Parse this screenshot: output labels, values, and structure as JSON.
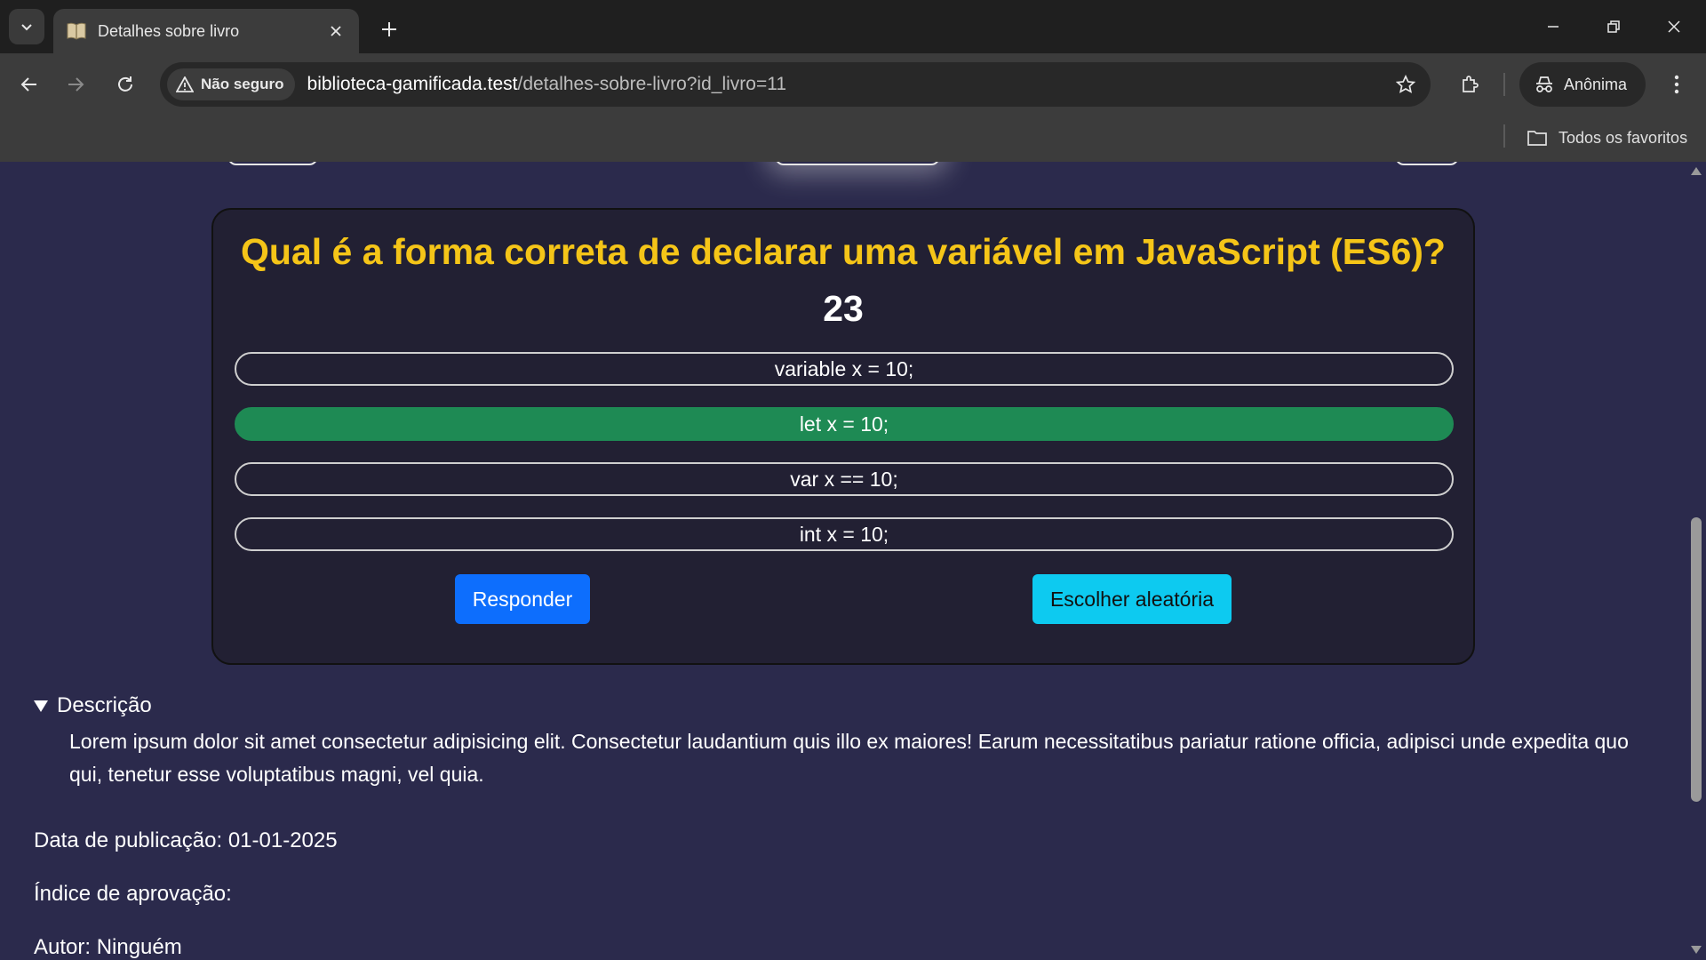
{
  "browser": {
    "tab_title": "Detalhes sobre livro",
    "security_label": "Não seguro",
    "url_host": "biblioteca-gamificada.test",
    "url_path": "/detalhes-sobre-livro?id_livro=11",
    "profile_label": "Anônima",
    "bookmarks_folder": "Todos os favoritos"
  },
  "quiz": {
    "question": "Qual é a forma correta de declarar uma variável em JavaScript (ES6)?",
    "number": "23",
    "options": [
      {
        "label": "variable x = 10;",
        "selected": false
      },
      {
        "label": "let x = 10;",
        "selected": true
      },
      {
        "label": "var x == 10;",
        "selected": false
      },
      {
        "label": "int x = 10;",
        "selected": false
      }
    ],
    "submit_label": "Responder",
    "random_label": "Escolher aleatória",
    "selected_color": "#1e8a54"
  },
  "details": {
    "summary_label": "Descrição",
    "description": "Lorem ipsum dolor sit amet consectetur adipisicing elit. Consectetur laudantium quis illo ex maiores! Earum necessitatibus pariatur ratione officia, adipisci unde expedita quo qui, tenetur esse voluptatibus magni, vel quia."
  },
  "meta": {
    "publication": "Data de publicação: 01-01-2025",
    "approval": "Índice de aprovação:",
    "author": "Autor: Ninguém"
  },
  "colors": {
    "accent_question": "#f5c518",
    "primary_button": "#0d6efd",
    "info_button": "#0dcaf0",
    "page_background": "#2b2a4c"
  }
}
